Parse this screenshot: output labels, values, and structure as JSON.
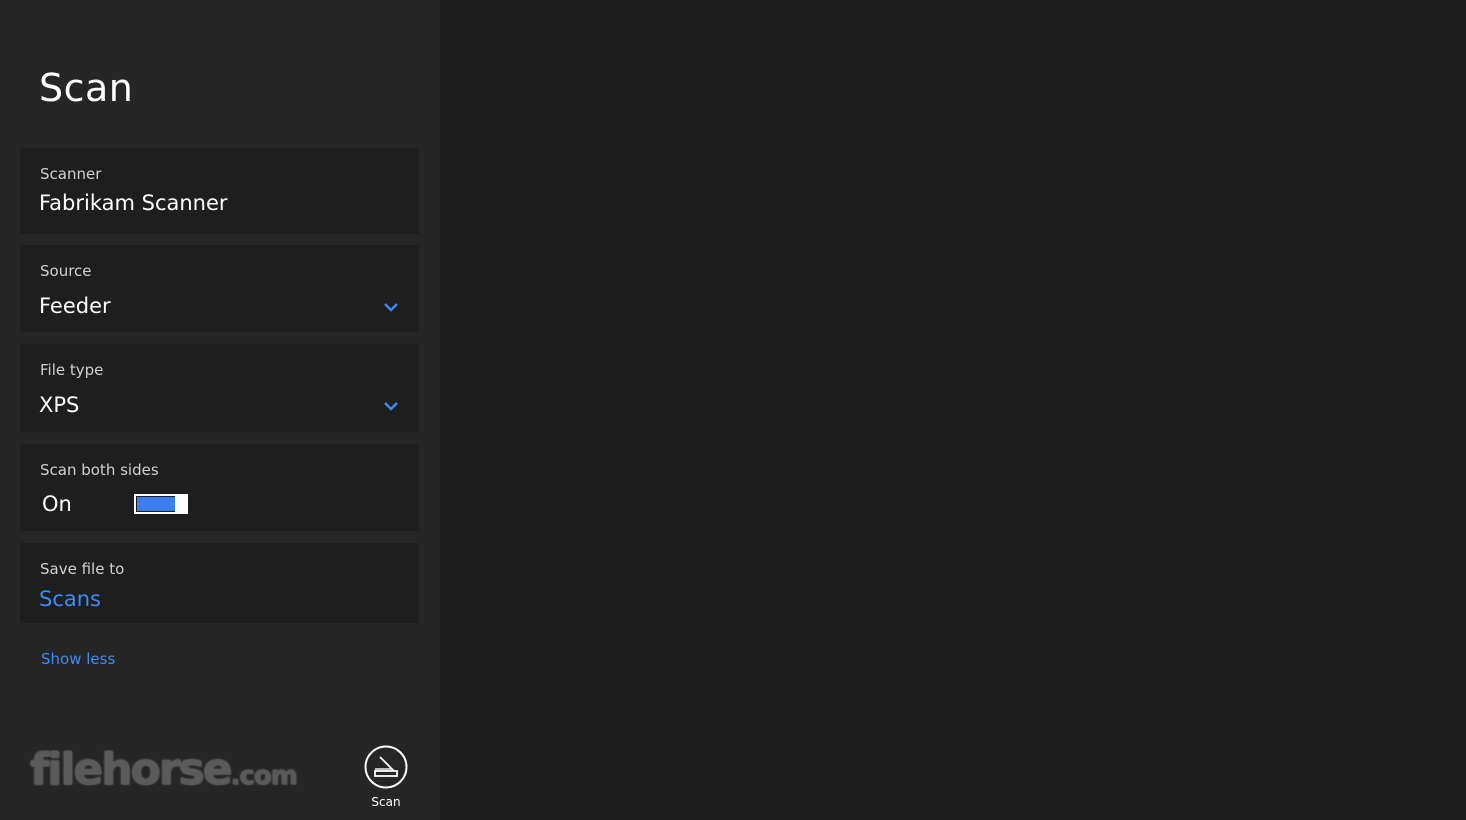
{
  "app": {
    "title": "Scan"
  },
  "scanner": {
    "label": "Scanner",
    "value": "Fabrikam Scanner"
  },
  "source": {
    "label": "Source",
    "value": "Feeder"
  },
  "file_type": {
    "label": "File type",
    "value": "XPS"
  },
  "scan_both_sides": {
    "label": "Scan both sides",
    "state_text": "On",
    "on": true
  },
  "save_file_to": {
    "label": "Save file to",
    "value": "Scans"
  },
  "show_less": {
    "label": "Show less"
  },
  "watermark": {
    "main": "filehorse",
    "suffix": ".com"
  },
  "app_bar": {
    "scan_label": "Scan"
  },
  "icons": {
    "dropdown": "chevron-down-icon",
    "scan": "scanner-icon"
  },
  "colors": {
    "accent": "#3b8cf5",
    "toggle_on": "#3b7ef0",
    "pane_bg": "#262626",
    "card_bg": "#1e1e1e",
    "canvas_bg": "#1d1d1d"
  }
}
